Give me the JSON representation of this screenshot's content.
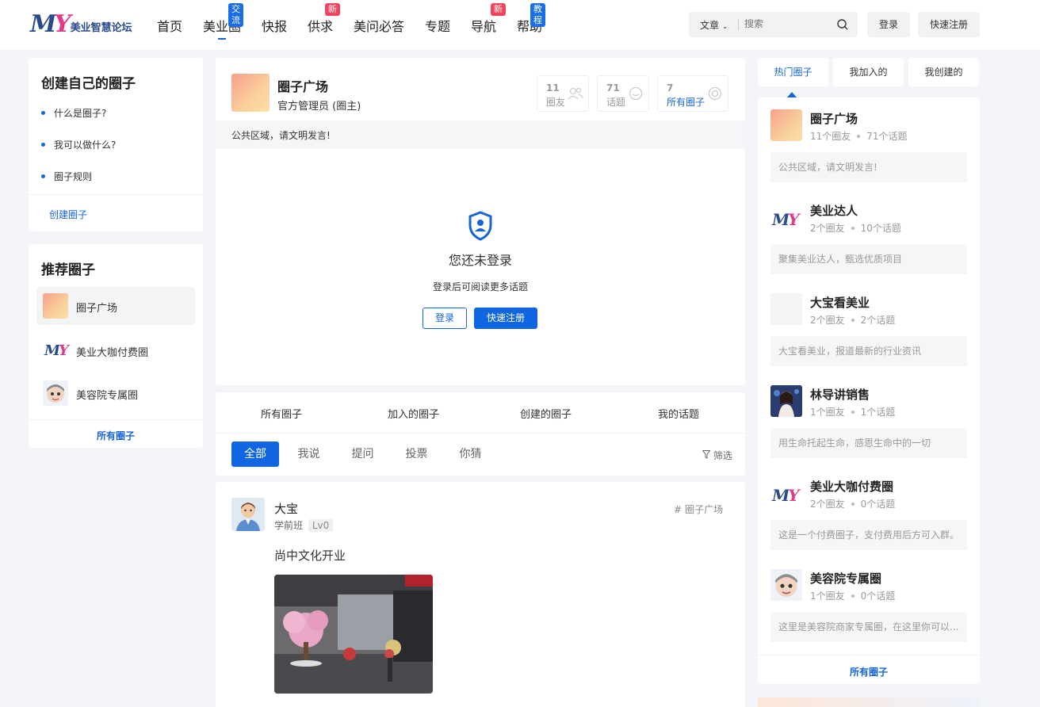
{
  "header": {
    "logo_text": "美业智慧论坛",
    "nav": [
      {
        "label": "首页"
      },
      {
        "label": "美业圈",
        "badge": "交流",
        "badge_color": "#1a6fe8",
        "active": true
      },
      {
        "label": "快报"
      },
      {
        "label": "供求",
        "badge": "新",
        "badge_color": "#f0455c"
      },
      {
        "label": "美问必答"
      },
      {
        "label": "专题"
      },
      {
        "label": "导航",
        "badge": "新",
        "badge_color": "#f0455c"
      },
      {
        "label": "帮助",
        "badge": "教程",
        "badge_color": "#1a6fe8"
      }
    ],
    "search_type": "文章",
    "search_placeholder": "搜索",
    "login": "登录",
    "register": "快速注册"
  },
  "left": {
    "create_card": {
      "title": "创建自己的圈子",
      "items": [
        "什么是圈子?",
        "我可以做什么?",
        "圈子规则"
      ],
      "link": "创建圈子"
    },
    "recommend_card": {
      "title": "推荐圈子",
      "items": [
        {
          "name": "圈子广场",
          "icon": "gradient-avatar"
        },
        {
          "name": "美业大咖付费圈",
          "icon": "my-logo"
        },
        {
          "name": "美容院专属圈",
          "icon": "cartoon-avatar"
        }
      ],
      "footer_link": "所有圈子"
    }
  },
  "center": {
    "circle": {
      "name": "圈子广场",
      "owner": "官方管理员 (圈主)",
      "stats": [
        {
          "num": "11",
          "label": "圈友",
          "icon": "users-icon"
        },
        {
          "num": "71",
          "label": "话题",
          "icon": "chat-icon"
        },
        {
          "num": "7",
          "label": "所有圈子",
          "icon": "circles-icon"
        }
      ],
      "notice": "公共区域，请文明发言!"
    },
    "login_prompt": {
      "title": "您还未登录",
      "subtitle": "登录后可阅读更多话题",
      "login": "登录",
      "register": "快速注册"
    },
    "tabs": [
      "所有圈子",
      "加入的圈子",
      "创建的圈子",
      "我的话题"
    ],
    "filters": [
      "全部",
      "我说",
      "提问",
      "投票",
      "你猜"
    ],
    "filter_button": "筛选",
    "post": {
      "author": "大宝",
      "level_text": "学前班",
      "level": "Lv0",
      "circle_tag": "圈子广场",
      "content": "尚中文化开业"
    }
  },
  "right": {
    "tabs": [
      "热门圈子",
      "我加入的",
      "我创建的"
    ],
    "circles": [
      {
        "name": "圈子广场",
        "members": "11个圈友",
        "topics": "71个话题",
        "desc": "公共区域，请文明发言!",
        "icon": "gradient-avatar"
      },
      {
        "name": "美业达人",
        "members": "2个圈友",
        "topics": "10个话题",
        "desc": "聚集美业达人，甄选优质项目",
        "icon": "my-logo"
      },
      {
        "name": "大宝看美业",
        "members": "2个圈友",
        "topics": "2个话题",
        "desc": "大宝看美业，报道最新的行业资讯",
        "icon": "blank-avatar"
      },
      {
        "name": "林导讲销售",
        "members": "1个圈友",
        "topics": "1个话题",
        "desc": "用生命托起生命，感恩生命中的一切",
        "icon": "photo-avatar"
      },
      {
        "name": "美业大咖付费圈",
        "members": "2个圈友",
        "topics": "0个话题",
        "desc": "这是一个付费圈子，支付费用后方可入群。",
        "icon": "my-logo"
      },
      {
        "name": "美容院专属圈",
        "members": "1个圈友",
        "topics": "0个话题",
        "desc": "这里是美容院商家专属圈，在这里你可以...",
        "icon": "cartoon-avatar"
      }
    ],
    "footer_link": "所有圈子"
  }
}
